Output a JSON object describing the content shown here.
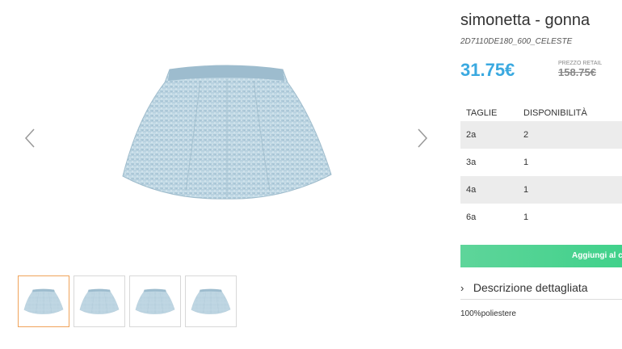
{
  "product": {
    "title": "simonetta - gonna",
    "sku": "2D7110DE180_600_CELESTE",
    "price": "31.75€",
    "retail_label": "PREZZO RETAIL",
    "retail_price": "158.75€"
  },
  "sizes_table": {
    "headers": [
      "TAGLIE",
      "DISPONIBILITÀ"
    ],
    "rows": [
      {
        "size": "2a",
        "availability": "2"
      },
      {
        "size": "3a",
        "availability": "1"
      },
      {
        "size": "4a",
        "availability": "1"
      },
      {
        "size": "6a",
        "availability": "1"
      }
    ]
  },
  "actions": {
    "add_to_cart": "Aggiungi al c"
  },
  "description": {
    "toggle_label": "Descrizione dettagliata",
    "text": "100%poliestere"
  },
  "gallery": {
    "icons": [
      "chevron-left-icon",
      "chevron-right-icon",
      "chevron-right-icon"
    ],
    "thumbnail_count": 4,
    "active_thumbnail": 1
  },
  "colors": {
    "price": "#3aa9e0",
    "add_button": "#4cd391",
    "thumb_active_border": "#f0a35a",
    "skirt": "#b9d3e0"
  }
}
